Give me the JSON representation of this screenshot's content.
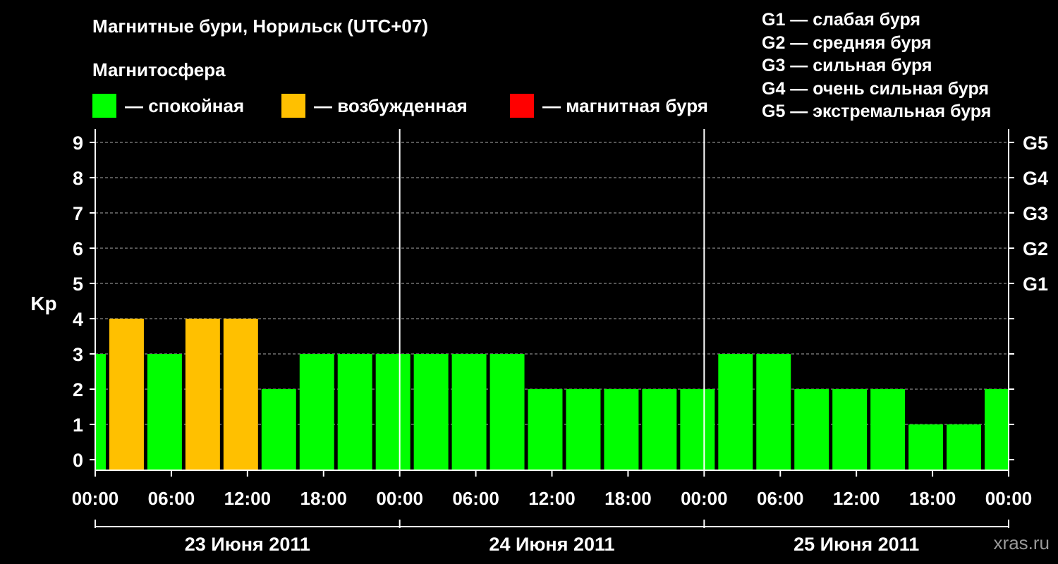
{
  "chart_data": {
    "type": "bar",
    "title": "Магнитные бури, Норильск (UTC+07)",
    "subtitle": "Магнитосфера",
    "ylabel": "Kp",
    "ylim": [
      0,
      9
    ],
    "yticks": [
      "0",
      "1",
      "2",
      "3",
      "4",
      "5",
      "6",
      "7",
      "8",
      "9"
    ],
    "right_ticks": [
      {
        "value": 5,
        "label": "G1"
      },
      {
        "value": 6,
        "label": "G2"
      },
      {
        "value": 7,
        "label": "G3"
      },
      {
        "value": 8,
        "label": "G4"
      },
      {
        "value": 9,
        "label": "G5"
      }
    ],
    "grid": true,
    "x_tick_labels": [
      "00:00",
      "06:00",
      "12:00",
      "18:00",
      "00:00",
      "06:00",
      "12:00",
      "18:00",
      "00:00",
      "06:00",
      "12:00",
      "18:00",
      "00:00"
    ],
    "x_range_hours": [
      0,
      72
    ],
    "bar_span_hours": 3,
    "first_bar_start_hours": -2,
    "days": [
      "23 Июня 2011",
      "24 Июня 2011",
      "25 Июня 2011"
    ],
    "values": [
      3,
      4,
      3,
      4,
      4,
      2,
      3,
      3,
      3,
      3,
      3,
      3,
      2,
      2,
      2,
      2,
      2,
      3,
      3,
      2,
      2,
      2,
      1,
      1,
      2
    ],
    "status_thresholds": {
      "quiet_max": 3,
      "active_max": 4
    },
    "colors": {
      "quiet": "#00ff00",
      "active": "#ffc000",
      "storm": "#ff0000",
      "background": "#000000",
      "axis": "#ffffff",
      "grid": "#aaaaaa"
    }
  },
  "legend": [
    {
      "label": "— спокойная",
      "color": "#00ff00"
    },
    {
      "label": "— возбужденная",
      "color": "#ffc000"
    },
    {
      "label": "— магнитная буря",
      "color": "#ff0000"
    }
  ],
  "storm_levels": [
    "G1 — слабая буря",
    "G2 — средняя буря",
    "G3 — сильная буря",
    "G4 — очень сильная буря",
    "G5 — экстремальная буря"
  ],
  "watermark": "xras.ru"
}
